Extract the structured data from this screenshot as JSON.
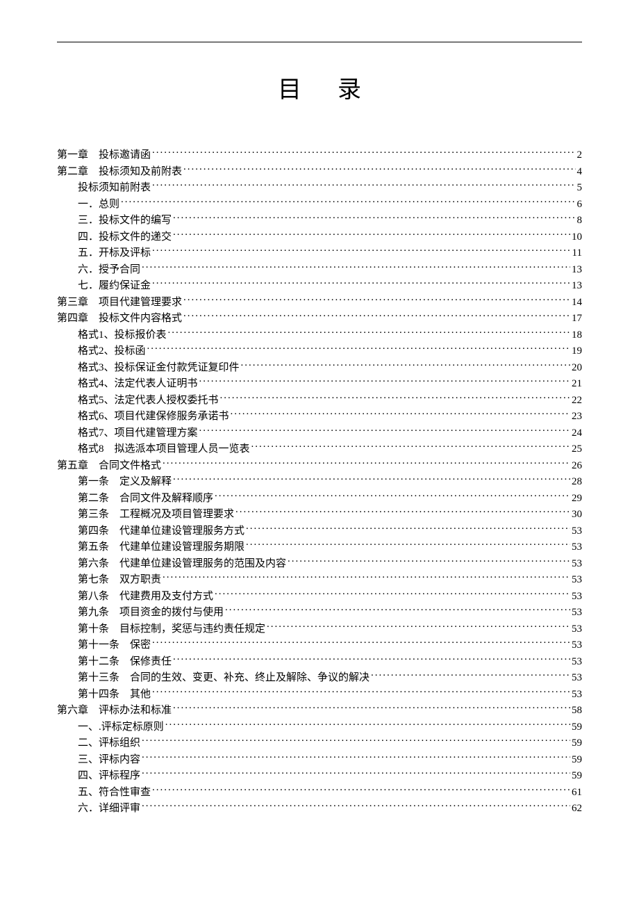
{
  "title": "目录",
  "toc": [
    {
      "level": 0,
      "label": "第一章　投标邀请函",
      "page": "2"
    },
    {
      "level": 0,
      "label": "第二章　投标须知及前附表",
      "page": "4"
    },
    {
      "level": 1,
      "label": "投标须知前附表",
      "page": "5"
    },
    {
      "level": 1,
      "label": "一．总则",
      "page": "6"
    },
    {
      "level": 1,
      "label": "三．投标文件的编写",
      "page": "8"
    },
    {
      "level": 1,
      "label": "四．投标文件的递交",
      "page": "10"
    },
    {
      "level": 1,
      "label": "五．开标及评标",
      "page": "11"
    },
    {
      "level": 1,
      "label": "六．授予合同",
      "page": "13"
    },
    {
      "level": 1,
      "label": "七．履约保证金",
      "page": "13"
    },
    {
      "level": 0,
      "label": "第三章　项目代建管理要求",
      "page": "14"
    },
    {
      "level": 0,
      "label": "第四章　投标文件内容格式",
      "page": "17"
    },
    {
      "level": 1,
      "label": "格式1、投标报价表",
      "page": "18"
    },
    {
      "level": 1,
      "label": "格式2、投标函",
      "page": "19"
    },
    {
      "level": 1,
      "label": "格式3、投标保证金付款凭证复印件",
      "page": "20"
    },
    {
      "level": 1,
      "label": "格式4、法定代表人证明书",
      "page": "21"
    },
    {
      "level": 1,
      "label": "格式5、法定代表人授权委托书",
      "page": "22"
    },
    {
      "level": 1,
      "label": "格式6、项目代建保修服务承诺书",
      "page": "23"
    },
    {
      "level": 1,
      "label": "格式7、项目代建管理方案",
      "page": "24"
    },
    {
      "level": 1,
      "label": "格式8　拟选派本项目管理人员一览表",
      "page": "25"
    },
    {
      "level": 0,
      "label": "第五章　合同文件格式",
      "page": "26"
    },
    {
      "level": 1,
      "label": "第一条　定义及解释",
      "page": "28"
    },
    {
      "level": 1,
      "label": "第二条　合同文件及解释顺序",
      "page": "29"
    },
    {
      "level": 1,
      "label": "第三条　工程概况及项目管理要求",
      "page": "30"
    },
    {
      "level": 1,
      "label": "第四条　代建单位建设管理服务方式",
      "page": "53"
    },
    {
      "level": 1,
      "label": "第五条　代建单位建设管理服务期限",
      "page": "53"
    },
    {
      "level": 1,
      "label": "第六条　代建单位建设管理服务的范围及内容",
      "page": "53"
    },
    {
      "level": 1,
      "label": "第七条　双方职责",
      "page": "53"
    },
    {
      "level": 1,
      "label": "第八条　代建费用及支付方式",
      "page": "53"
    },
    {
      "level": 1,
      "label": "第九条　项目资金的拨付与使用",
      "page": "53"
    },
    {
      "level": 1,
      "label": "第十条　目标控制，奖惩与违约责任规定",
      "page": "53"
    },
    {
      "level": 1,
      "label": "第十一条　保密",
      "page": "53"
    },
    {
      "level": 1,
      "label": "第十二条　保修责任",
      "page": "53"
    },
    {
      "level": 1,
      "label": "第十三条　合同的生效、变更、补充、终止及解除、争议的解决",
      "page": "53"
    },
    {
      "level": 1,
      "label": "第十四条　其他",
      "page": "53"
    },
    {
      "level": 0,
      "label": "第六章　评标办法和标准",
      "page": "58"
    },
    {
      "level": 1,
      "label": "一、.评标定标原则",
      "page": "59"
    },
    {
      "level": 1,
      "label": "二、评标组织",
      "page": "59"
    },
    {
      "level": 1,
      "label": "三、评标内容",
      "page": "59"
    },
    {
      "level": 1,
      "label": "四、评标程序",
      "page": "59"
    },
    {
      "level": 1,
      "label": "五、符合性审查",
      "page": "61"
    },
    {
      "level": 1,
      "label": "六．详细评审",
      "page": "62"
    }
  ]
}
